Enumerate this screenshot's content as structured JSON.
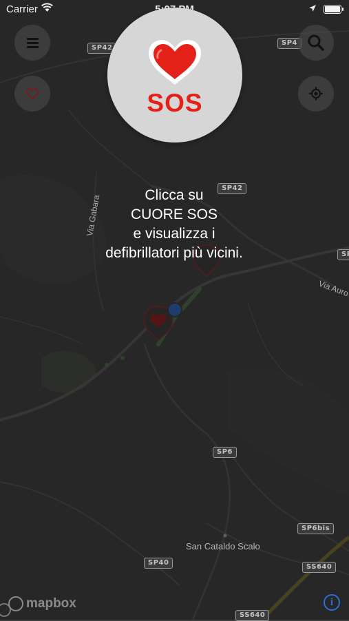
{
  "status_bar": {
    "carrier": "Carrier",
    "time": "5:07 PM"
  },
  "sos": {
    "label": "SOS",
    "heart_color": "#e32119"
  },
  "instructions": {
    "lines": [
      "Clicca su",
      "CUORE SOS",
      "e visualizza i",
      "defibrillatori più vicini."
    ]
  },
  "map": {
    "road_labels": [
      "SP42",
      "SP4",
      "SP42",
      "SP",
      "SP6",
      "SP6bis",
      "SP40",
      "SS640",
      "SS640"
    ],
    "place_labels": [
      "Via Gabara",
      "Via Auro",
      "San Cataldo Scalo"
    ],
    "attribution": "mapbox"
  },
  "buttons": {
    "menu_icon": "hamburger-icon",
    "favorites_icon": "heart-outline-icon",
    "search_icon": "search-icon",
    "locate_icon": "crosshair-icon",
    "info_icon": "info-icon"
  },
  "colors": {
    "accent_red": "#e32119",
    "user_location": "#2d6fd6",
    "info_blue": "#2d6fd6"
  }
}
